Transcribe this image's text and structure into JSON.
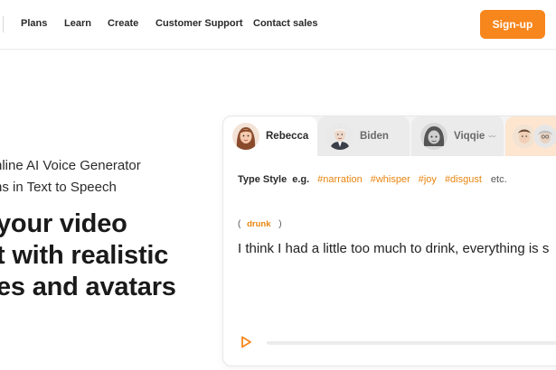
{
  "nav": {
    "links": [
      "Plans",
      "Learn",
      "Create",
      "Customer Support",
      "Contact sales"
    ],
    "signup_label": "Sign-up"
  },
  "hero": {
    "subtitle_line1": "nline AI Voice Generator",
    "subtitle_line2": "ns in Text to Speech",
    "title_line1": "your video",
    "title_line2": "t with realistic",
    "title_line3": "es and avatars"
  },
  "demo": {
    "tabs": [
      {
        "label": "Rebecca",
        "active": true
      },
      {
        "label": "Biden",
        "active": false
      },
      {
        "label": "Viqqie",
        "active": false
      }
    ],
    "type_style_label": "Type Style",
    "eg_label": "e.g.",
    "tags": [
      "#narration",
      "#whisper",
      "#joy",
      "#disgust"
    ],
    "etc_label": "etc.",
    "emotion_open": "(",
    "emotion_word": "drunk",
    "emotion_close": ")",
    "sentence": "I think I had a little too much to drink, everything is s",
    "colors": {
      "accent": "#f7861c",
      "tag": "#e8850f"
    }
  }
}
